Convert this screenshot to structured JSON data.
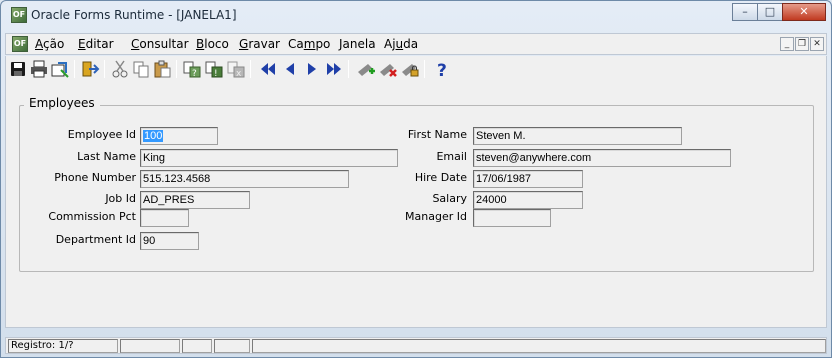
{
  "window": {
    "title": "Oracle Forms Runtime - [JANELA1]",
    "app_icon_text": "OF"
  },
  "menu": {
    "items": [
      {
        "label": "Ação",
        "accel": "A"
      },
      {
        "label": "Editar",
        "accel": "E"
      },
      {
        "label": "Consultar",
        "accel": "C"
      },
      {
        "label": "Bloco",
        "accel": "B"
      },
      {
        "label": "Gravar",
        "accel": "G"
      },
      {
        "label": "Campo",
        "accel": "m"
      },
      {
        "label": "Janela",
        "accel": ""
      },
      {
        "label": "Ajuda",
        "accel": "u"
      }
    ]
  },
  "toolbar": {
    "icons": [
      "save-icon",
      "print-icon",
      "clear-form-icon",
      "exit-icon",
      "cut-icon",
      "copy-icon",
      "paste-icon",
      "enter-query-icon",
      "execute-query-icon",
      "cancel-query-icon",
      "first-record-icon",
      "previous-record-icon",
      "next-record-icon",
      "last-record-icon",
      "insert-record-icon",
      "delete-record-icon",
      "lock-record-icon",
      "help-icon"
    ]
  },
  "form": {
    "group_title": "Employees",
    "fields": {
      "employee_id": {
        "label": "Employee Id",
        "value": "100"
      },
      "last_name": {
        "label": "Last Name",
        "value": "King"
      },
      "phone_number": {
        "label": "Phone Number",
        "value": "515.123.4568"
      },
      "job_id": {
        "label": "Job Id",
        "value": "AD_PRES"
      },
      "commission_pct": {
        "label": "Commission Pct",
        "value": ""
      },
      "department_id": {
        "label": "Department Id",
        "value": "90"
      },
      "first_name": {
        "label": "First Name",
        "value": "Steven M."
      },
      "email": {
        "label": "Email",
        "value": "steven@anywhere.com"
      },
      "hire_date": {
        "label": "Hire Date",
        "value": "17/06/1987"
      },
      "salary": {
        "label": "Salary",
        "value": "24000"
      },
      "manager_id": {
        "label": "Manager Id",
        "value": ""
      }
    }
  },
  "status": {
    "record": "Registro: 1/?"
  }
}
